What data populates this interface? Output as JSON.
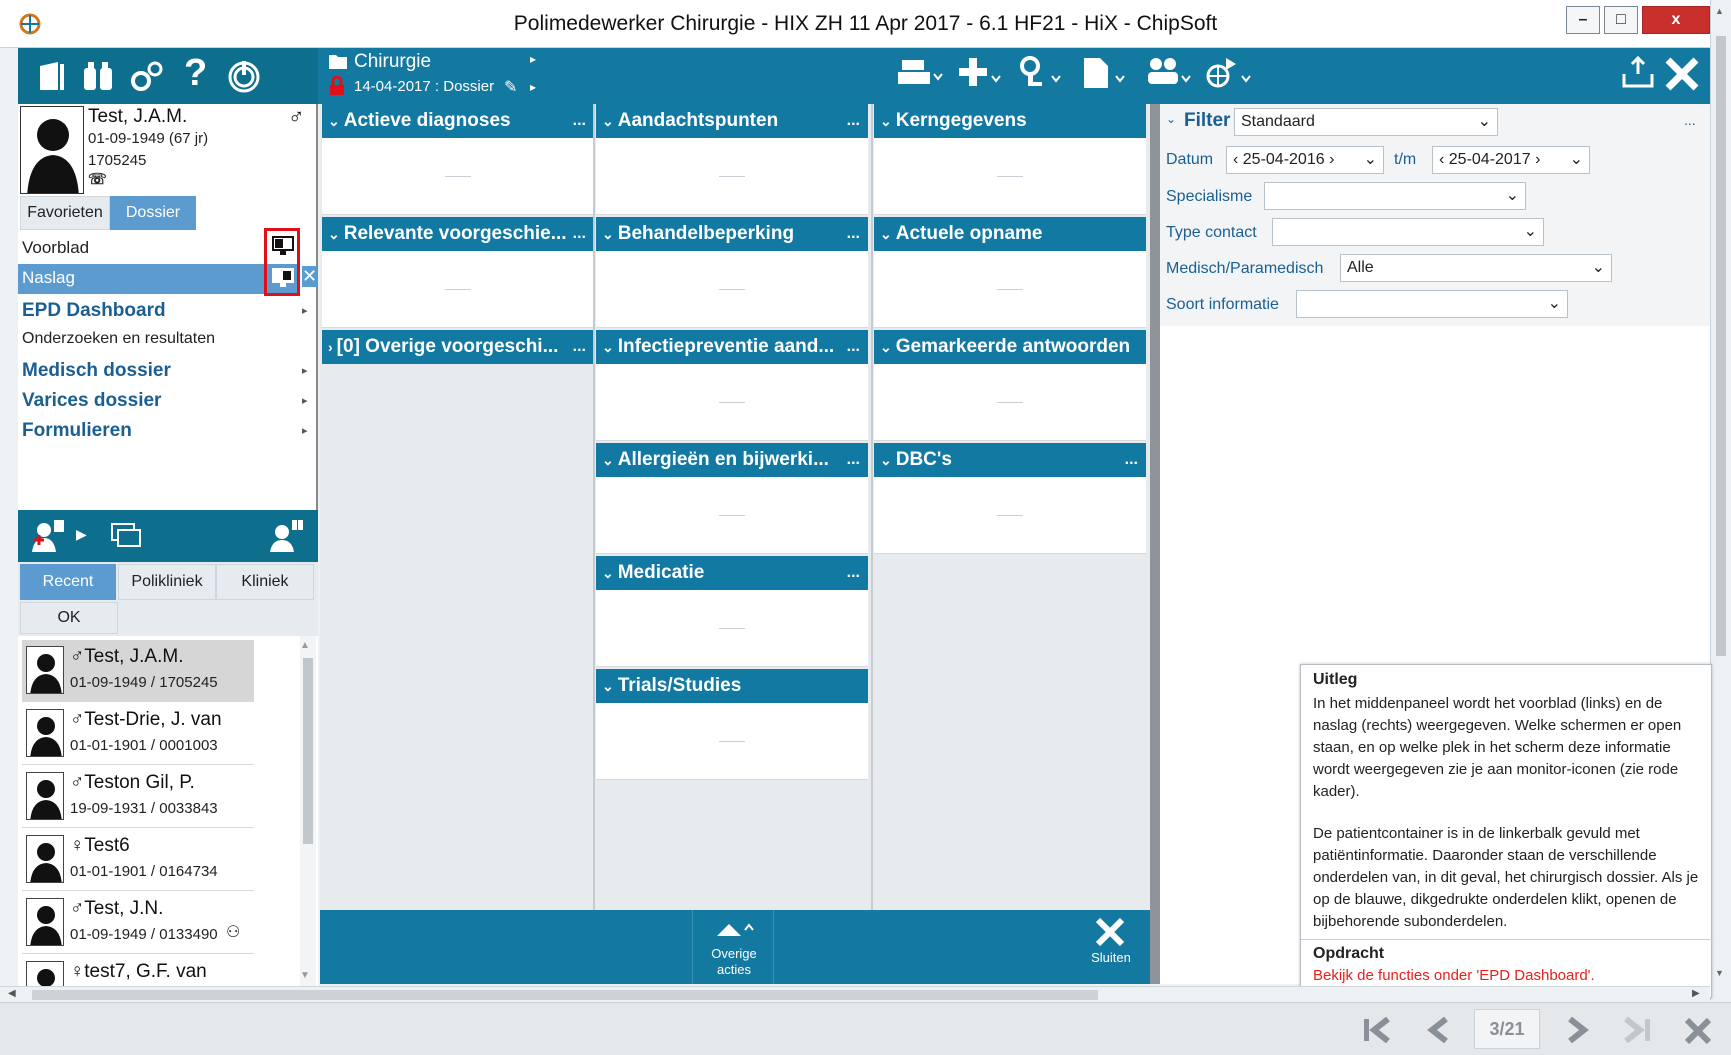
{
  "window": {
    "title": "Polimedewerker Chirurgie - HIX ZH 11 Apr 2017 - 6.1 HF21 - HiX - ChipSoft",
    "min": "–",
    "max": "□",
    "close": "x"
  },
  "left_toolbar": {
    "help": "?",
    "power": "⏻"
  },
  "context": {
    "department": "Chirurgie",
    "date_dossier": "14-04-2017 : Dossier"
  },
  "patient": {
    "name": "Test, J.A.M.",
    "dob": "01-09-1949 (67 jr)",
    "id": "1705245",
    "phone_icon": "phone-icon",
    "gender": "♂"
  },
  "tabs": {
    "favorites": "Favorieten",
    "dossier": "Dossier"
  },
  "nav": [
    {
      "label": "Voorblad"
    },
    {
      "label": "Naslag"
    },
    {
      "label": "EPD Dashboard"
    },
    {
      "label": "Onderzoeken en resultaten"
    },
    {
      "label": "Medisch dossier"
    },
    {
      "label": "Varices dossier"
    },
    {
      "label": "Formulieren"
    }
  ],
  "patient_list": {
    "tabs": [
      "Recent",
      "Polikliniek",
      "Kliniek"
    ],
    "ok": "OK",
    "rows": [
      {
        "gender": "♂",
        "name": "Test, J.A.M.",
        "sub": "01-09-1949 / 1705245"
      },
      {
        "gender": "♂",
        "name": "Test-Drie, J. van",
        "sub": "01-01-1901 / 0001003"
      },
      {
        "gender": "♂",
        "name": "Teston Gil, P.",
        "sub": "19-09-1931 / 0033843"
      },
      {
        "gender": "♀",
        "name": "Test6",
        "sub": "01-01-1901 / 0164734"
      },
      {
        "gender": "♂",
        "name": "Test, J.N.",
        "sub": "01-09-1949 / 0133490"
      },
      {
        "gender": "♀",
        "name": "test7, G.F. van",
        "sub": ""
      }
    ]
  },
  "panels": {
    "col1": [
      "Actieve diagnoses",
      "Relevante voorgeschie...",
      "[0] Overige voorgeschi..."
    ],
    "col2": [
      "Aandachtspunten",
      "Behandelbeperking",
      "Infectiepreventie aand...",
      "Allergieën en bijwerki...",
      "Medicatie",
      "Trials/Studies"
    ],
    "col3": [
      "Kerngegevens",
      "Actuele opname",
      "Gemarkeerde antwoorden",
      "DBC's"
    ],
    "dots": "..."
  },
  "bottom_actions": {
    "overige": "Overige acties",
    "sluiten": "Sluiten"
  },
  "filter": {
    "label": "Filter",
    "preset": "Standaard",
    "datum_label": "Datum",
    "date_from": "25-04-2016",
    "tm": "t/m",
    "date_to": "25-04-2017",
    "specialisme": "Specialisme",
    "type_contact": "Type contact",
    "medisch": "Medisch/Paramedisch",
    "medisch_value": "Alle",
    "soort": "Soort informatie"
  },
  "uitleg": {
    "title": "Uitleg",
    "p1": "In het middenpaneel wordt het voorblad (links) en de naslag (rechts) weergegeven. Welke schermen er open staan, en op welke plek in het scherm deze informatie wordt weergegeven zie je aan monitor-iconen (zie rode kader).",
    "p2": "De patientcontainer is in de linkerbalk gevuld met patiëntinformatie. Daaronder staan de verschillende onderdelen van, in dit geval, het chirurgisch dossier. Als je op de blauwe, dikgedrukte onderdelen klikt, openen de bijbehorende subonderdelen.",
    "opdracht_title": "Opdracht",
    "opdracht": "Bekijk de functies onder 'EPD Dashboard'."
  },
  "pager": {
    "page": "3/21"
  },
  "colors": {
    "teal": "#1479a0",
    "teal_dark": "#0e6e8e",
    "nav_selected": "#5b9bd0",
    "link_blue": "#1b5f92",
    "highlight_red": "#e0101a",
    "opdracht_red": "#e8211a"
  }
}
